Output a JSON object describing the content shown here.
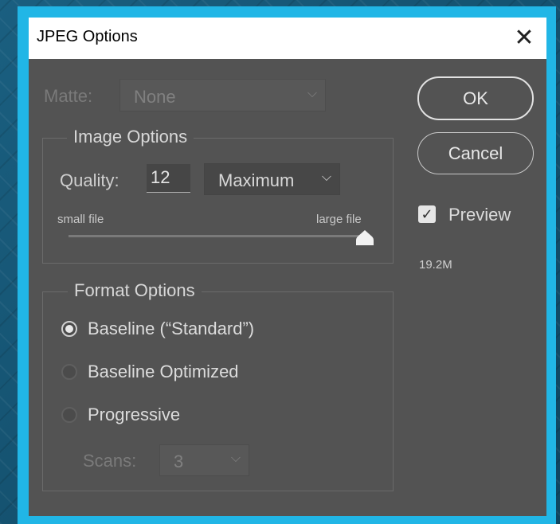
{
  "window": {
    "title": "JPEG Options",
    "close_icon": "close-icon"
  },
  "matte": {
    "label": "Matte:",
    "value": "None"
  },
  "image_options": {
    "legend": "Image Options",
    "quality_label": "Quality:",
    "quality_value": "12",
    "quality_preset": "Maximum",
    "slider_min_label": "small file",
    "slider_max_label": "large file",
    "slider_level": 1.0
  },
  "format_options": {
    "legend": "Format Options",
    "options": [
      {
        "label": "Baseline (“Standard”)",
        "selected": true
      },
      {
        "label": "Baseline Optimized",
        "selected": false
      },
      {
        "label": "Progressive",
        "selected": false
      }
    ],
    "scans_label": "Scans:",
    "scans_value": "3"
  },
  "buttons": {
    "ok": "OK",
    "cancel": "Cancel"
  },
  "preview": {
    "label": "Preview",
    "checked": true,
    "size": "19.2M"
  },
  "colors": {
    "frame": "#21b6e6",
    "dialog": "#535353",
    "titlebar": "#ffffff"
  }
}
